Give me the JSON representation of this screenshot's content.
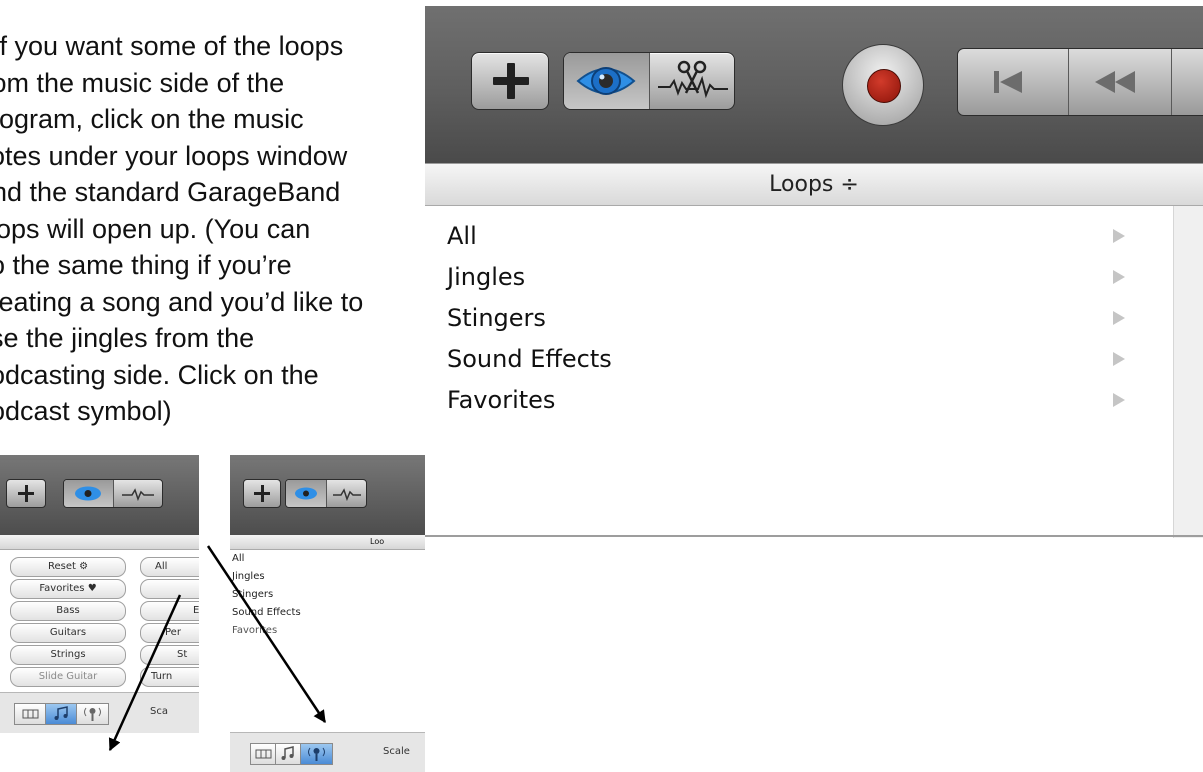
{
  "instructions": {
    "lines": [
      "If you want some of the loops",
      "from the music side of the",
      "program, click on the music",
      "notes under your loops window",
      "and the standard GarageBand",
      "loops will open up.  (You can",
      "do the same thing if you’re",
      "creating a song and you’d like to",
      "use the jingles from the",
      "podcasting side.  Click on the",
      "podcast symbol)"
    ]
  },
  "big_panel": {
    "header": "Loops ÷",
    "items": [
      "All",
      "Jingles",
      "Stingers",
      "Sound Effects",
      "Favorites"
    ],
    "icons": {
      "add": "plus-icon",
      "view": "eye-icon",
      "editor": "scissors-waveform-icon",
      "record": "record-icon",
      "transport_start": "go-to-start-icon",
      "transport_rewind": "rewind-icon"
    }
  },
  "music_panel": {
    "buttons": [
      "Reset",
      "All",
      "Favorites",
      "Bass",
      "Guitars",
      "Strings",
      "Slide Guitar",
      "E",
      "Per",
      "St",
      "Turn"
    ],
    "scale": "Sca"
  },
  "podcast_panel": {
    "header": "Loo",
    "items": [
      "All",
      "Jingles",
      "Stingers",
      "Sound Effects",
      "Favorites"
    ],
    "scale": "Scale"
  }
}
